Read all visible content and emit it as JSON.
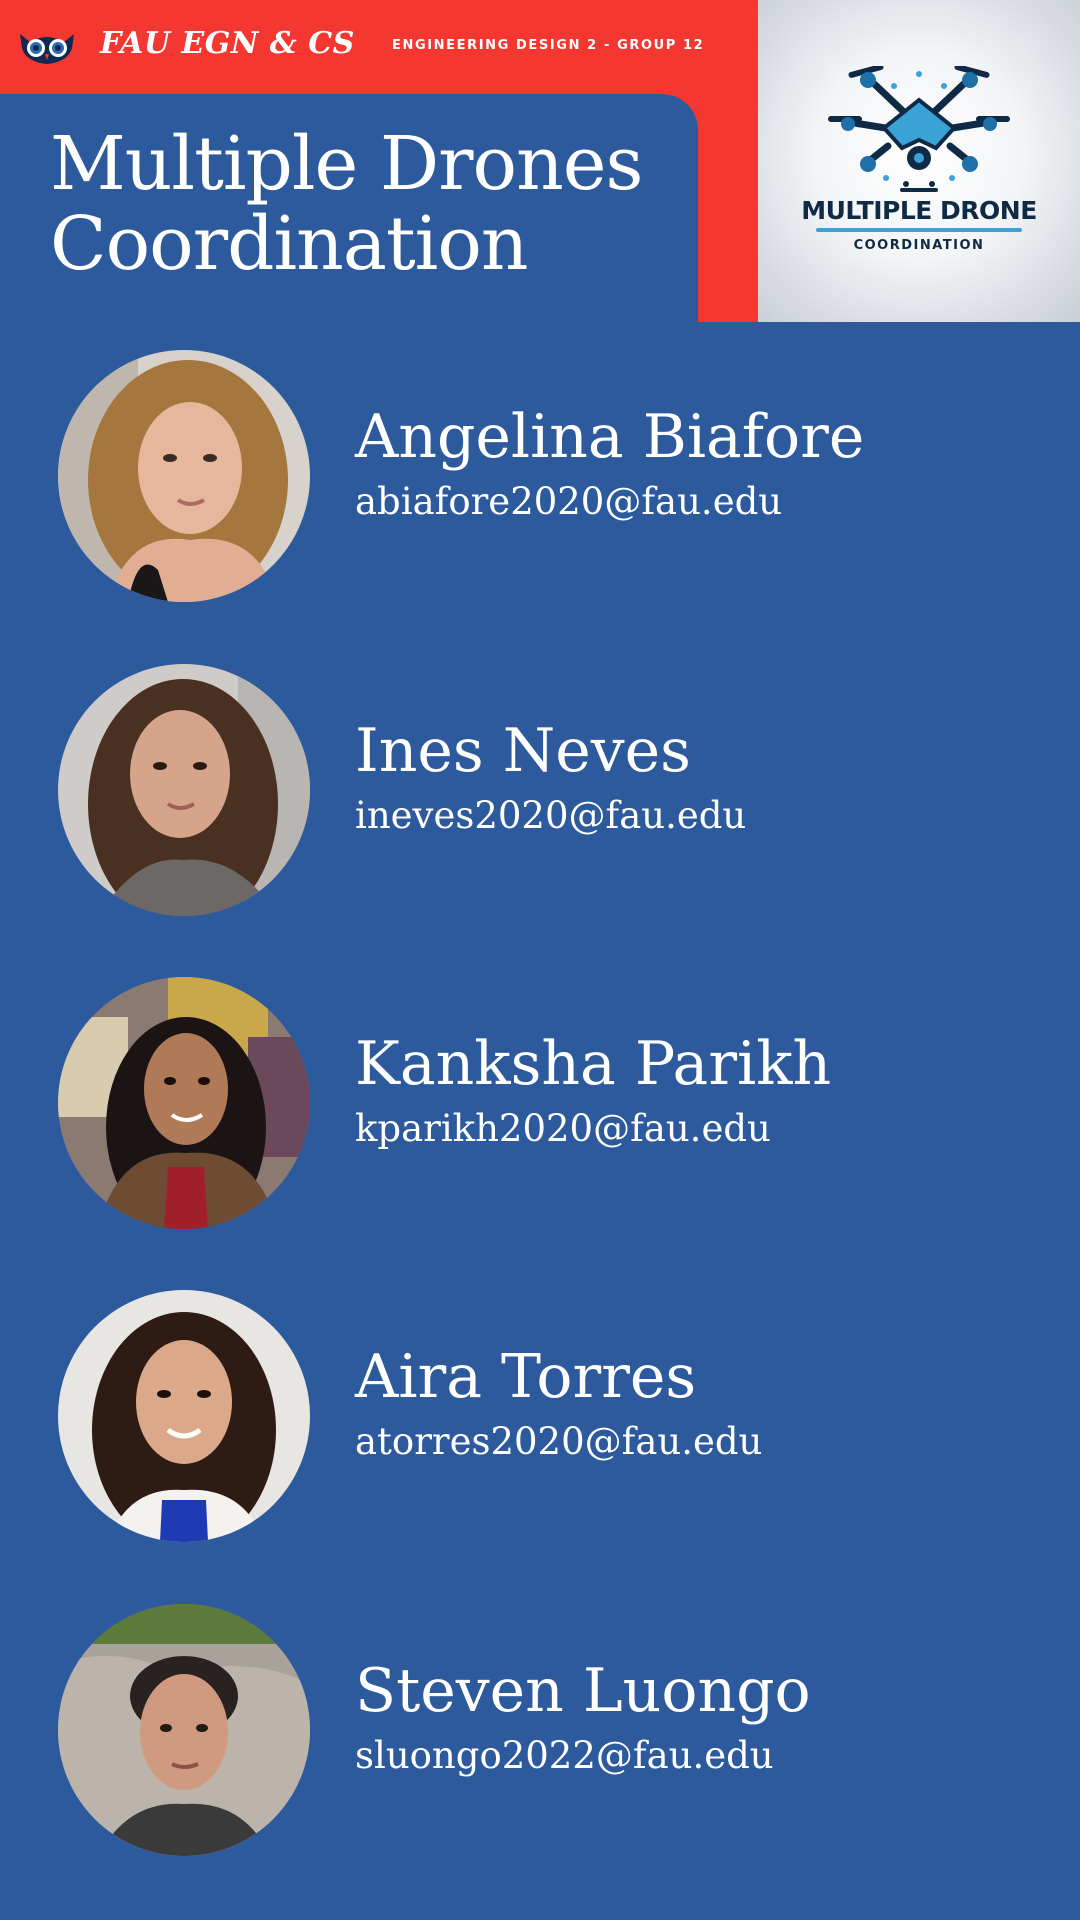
{
  "header": {
    "brand": "FAU EGN & CS",
    "subtitle": "ENGINEERING DESIGN 2 - GROUP 12",
    "title_line1": "Multiple Drones",
    "title_line2": "Coordination",
    "logo_title": "MULTIPLE DRONE",
    "logo_subtitle": "COORDINATION",
    "logo_icon": "drone-icon",
    "brand_icon": "owl-icon"
  },
  "colors": {
    "background": "#2d5a9d",
    "accent_red": "#f43730",
    "text": "#ffffff",
    "logo_dark": "#0f2a44",
    "logo_blue": "#3aa2d6"
  },
  "members": [
    {
      "name": "Angelina Biafore",
      "email": "abiafore2020@fau.edu",
      "photo": "avatar"
    },
    {
      "name": "Ines Neves",
      "email": "ineves2020@fau.edu",
      "photo": "avatar"
    },
    {
      "name": "Kanksha Parikh",
      "email": "kparikh2020@fau.edu",
      "photo": "avatar"
    },
    {
      "name": "Aira Torres",
      "email": "atorres2020@fau.edu",
      "photo": "avatar"
    },
    {
      "name": "Steven Luongo",
      "email": "sluongo2022@fau.edu",
      "photo": "avatar"
    }
  ]
}
